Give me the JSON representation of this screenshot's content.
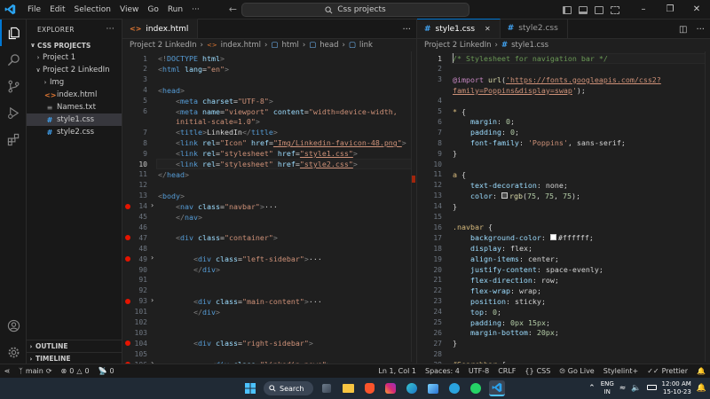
{
  "titlebar": {
    "menu": [
      "File",
      "Edit",
      "Selection",
      "View",
      "Go",
      "Run",
      "···"
    ],
    "search": "Css projects"
  },
  "sidebar": {
    "header": "EXPLORER",
    "section": "CSS PROJECTS",
    "items": [
      {
        "label": "Project 1",
        "type": "folder",
        "expanded": false
      },
      {
        "label": "Project 2 LinkedIn",
        "type": "folder",
        "expanded": true
      },
      {
        "label": "Img",
        "type": "folder",
        "expanded": false
      },
      {
        "label": "index.html",
        "type": "html"
      },
      {
        "label": "Names.txt",
        "type": "txt"
      },
      {
        "label": "style1.css",
        "type": "css",
        "selected": true
      },
      {
        "label": "style2.css",
        "type": "css"
      }
    ],
    "outline": "OUTLINE",
    "timeline": "TIMELINE"
  },
  "left_editor": {
    "tab": "index.html",
    "breadcrumb": [
      "Project 2 LinkedIn",
      "index.html",
      "html",
      "head",
      "link"
    ],
    "lines": [
      {
        "n": "1",
        "t": "<!DOCTYPE html>"
      },
      {
        "n": "2",
        "t": "<html lang=\"en\">"
      },
      {
        "n": "3",
        "t": ""
      },
      {
        "n": "4",
        "t": "<head>"
      },
      {
        "n": "5",
        "t": "    <meta charset=\"UTF-8\">"
      },
      {
        "n": "6",
        "t": "    <meta name=\"viewport\" content=\"width=device-width,"
      },
      {
        "n": "",
        "t": "    initial-scale=1.0\">"
      },
      {
        "n": "7",
        "t": "    <title>LinkedIn</title>"
      },
      {
        "n": "8",
        "t": "    <link rel=\"Icon\" href=\"Img/Linkedin-favicon-48.png\">"
      },
      {
        "n": "9",
        "t": "    <link rel=\"stylesheet\" href=\"style1.css\">"
      },
      {
        "n": "10",
        "t": "    <link rel=\"stylesheet\" href=\"style2.css\">"
      },
      {
        "n": "11",
        "t": "</head>"
      },
      {
        "n": "12",
        "t": ""
      },
      {
        "n": "13",
        "t": "<body>"
      },
      {
        "n": "14",
        "t": "    <nav class=\"navbar\">···"
      },
      {
        "n": "45",
        "t": "    </nav>"
      },
      {
        "n": "46",
        "t": ""
      },
      {
        "n": "47",
        "t": "    <div class=\"container\">"
      },
      {
        "n": "48",
        "t": ""
      },
      {
        "n": "49",
        "t": "        <div class=\"left-sidebar\">···"
      },
      {
        "n": "90",
        "t": "        </div>"
      },
      {
        "n": "91",
        "t": ""
      },
      {
        "n": "92",
        "t": ""
      },
      {
        "n": "93",
        "t": "        <div class=\"main-content\">···"
      },
      {
        "n": "101",
        "t": "        </div>"
      },
      {
        "n": "102",
        "t": ""
      },
      {
        "n": "103",
        "t": ""
      },
      {
        "n": "104",
        "t": "        <div class=\"right-sidebar\">"
      },
      {
        "n": "105",
        "t": ""
      },
      {
        "n": "106",
        "t": "            <div class=\"linkedin-news\">···"
      }
    ]
  },
  "right_editor": {
    "tabs": [
      "style1.css",
      "style2.css"
    ],
    "breadcrumb": [
      "Project 2 LinkedIn",
      "style1.css"
    ],
    "lines": [
      {
        "n": "1",
        "t": "/* Stylesheet for navigation bar */"
      },
      {
        "n": "2",
        "t": ""
      },
      {
        "n": "3",
        "t": "@import url('https://fonts.googleapis.com/css2?"
      },
      {
        "n": "",
        "t": "family=Poppins&display=swap');"
      },
      {
        "n": "4",
        "t": ""
      },
      {
        "n": "5",
        "t": "* {"
      },
      {
        "n": "6",
        "t": "    margin: 0;"
      },
      {
        "n": "7",
        "t": "    padding: 0;"
      },
      {
        "n": "8",
        "t": "    font-family: 'Poppins', sans-serif;"
      },
      {
        "n": "9",
        "t": "}"
      },
      {
        "n": "10",
        "t": ""
      },
      {
        "n": "11",
        "t": "a {"
      },
      {
        "n": "12",
        "t": "    text-decoration: none;"
      },
      {
        "n": "13",
        "t": "    color: ■rgb(75, 75, 75);"
      },
      {
        "n": "14",
        "t": "}"
      },
      {
        "n": "15",
        "t": ""
      },
      {
        "n": "16",
        "t": ".navbar {"
      },
      {
        "n": "17",
        "t": "    background-color: □#ffffff;"
      },
      {
        "n": "18",
        "t": "    display: flex;"
      },
      {
        "n": "19",
        "t": "    align-items: center;"
      },
      {
        "n": "20",
        "t": "    justify-content: space-evenly;"
      },
      {
        "n": "21",
        "t": "    flex-direction: row;"
      },
      {
        "n": "22",
        "t": "    flex-wrap: wrap;"
      },
      {
        "n": "23",
        "t": "    position: sticky;"
      },
      {
        "n": "24",
        "t": "    top: 0;"
      },
      {
        "n": "25",
        "t": "    padding: 0px 15px;"
      },
      {
        "n": "26",
        "t": "    margin-bottom: 20px;"
      },
      {
        "n": "27",
        "t": "}"
      },
      {
        "n": "28",
        "t": ""
      },
      {
        "n": "29",
        "t": "#Searchbar {"
      }
    ]
  },
  "statusbar": {
    "branch": "main",
    "errors": "0",
    "warnings": "0",
    "ports": "0",
    "position": "Ln 1, Col 1",
    "spaces": "Spaces: 4",
    "encoding": "UTF-8",
    "eol": "CRLF",
    "language": "CSS",
    "golive": "Go Live",
    "stylelint": "Stylelint+",
    "prettier": "Prettier"
  },
  "taskbar": {
    "search": "Search",
    "lang": "ENG",
    "region": "IN",
    "time": "12:00 AM",
    "date": "15-10-23"
  },
  "colors": {
    "accent": "#0078d4",
    "breakpoint": "#e51400"
  }
}
